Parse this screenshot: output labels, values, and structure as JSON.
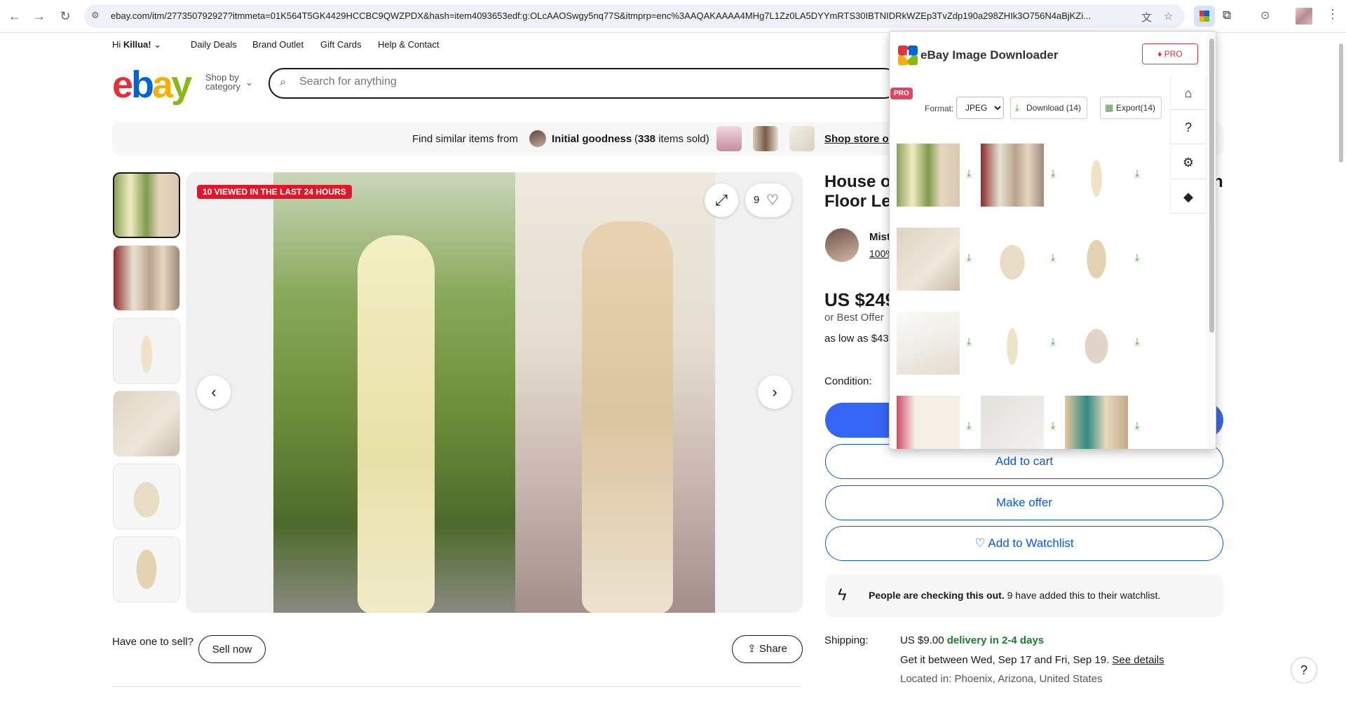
{
  "browser": {
    "url": "ebay.com/itm/277350792927?itmmeta=01K564T5GK4429HCCBC9QWZPDX&hash=item4093653edf:g:OLcAAOSwgy5nq77S&itmprp=enc%3AAQAKAAAA4MHg7L1Zz0LA5DYYmRTS30IBTNIDRkWZEp3TvZdp190a298ZHIk3O756N4aBjKZi..."
  },
  "topbar": {
    "greeting_prefix": "Hi ",
    "greeting_name": "Killua!",
    "links": [
      "Daily Deals",
      "Brand Outlet",
      "Gift Cards",
      "Help & Contact"
    ]
  },
  "search": {
    "shop_by": "Shop by",
    "category": "category",
    "placeholder": "Search for anything"
  },
  "similar": {
    "prefix": "Find similar items from",
    "store": "Initial goodness",
    "sold_open": "(",
    "sold_count": "338",
    "sold_suffix": " items sold)",
    "link": "Shop store or"
  },
  "gallery": {
    "badge": "10 VIEWED IN THE LAST 24 HOURS",
    "watch_count": "9"
  },
  "sell": {
    "text": "Have one to sell?",
    "button": "Sell now",
    "share": "Share"
  },
  "item": {
    "title_line1": "House of",
    "title_line2": "Floor Len",
    "title_end": "n",
    "seller_name": "Mist",
    "seller_feedback": "100%",
    "price": "US $249",
    "best_offer": "or Best Offer",
    "as_low_as": "as low as $43.",
    "condition_label": "Condition:",
    "add_to_cart": "Add to cart",
    "make_offer": "Make offer",
    "add_to_watchlist": "Add to Watchlist",
    "people_bold": "People are checking this out.",
    "people_rest": " 9 have added this to their watchlist."
  },
  "shipping": {
    "label": "Shipping:",
    "price": "US $9.00",
    "delivery": "delivery in 2-4 days",
    "between": "Get it between Wed, Sep 17 and Fri, Sep 19.",
    "see_details": "See details",
    "located": "Located in: Phoenix, Arizona, United States",
    "delivery_color": "#1d7a2e"
  },
  "popup": {
    "title": "eBay Image Downloader",
    "pro_button": "PRO",
    "pro_tag": "PRO",
    "format_label": "Format:",
    "format_value": "JPEG",
    "download": "Download (14)",
    "export": "Export(14)"
  },
  "colors": {
    "ebay_blue": "#3665f3",
    "badge_red": "#e0172b",
    "download_green": "#3a9b2f"
  }
}
